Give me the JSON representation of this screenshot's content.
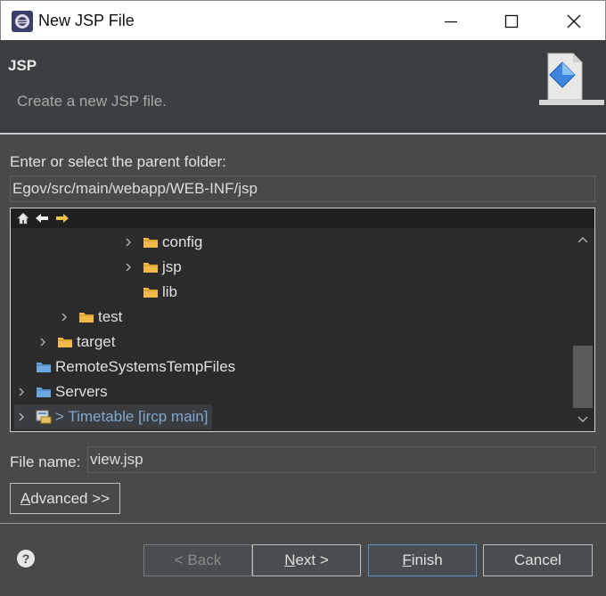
{
  "window": {
    "title": "New JSP File",
    "icon": "eclipse-icon"
  },
  "header": {
    "title": "JSP",
    "description": "Create a new JSP file."
  },
  "folder": {
    "label": "Enter or select the parent folder:",
    "value": "Egov/src/main/webapp/WEB-INF/jsp"
  },
  "tree": {
    "items": [
      {
        "label": "config",
        "expandable": true
      },
      {
        "label": "jsp",
        "expandable": true
      },
      {
        "label": "lib",
        "expandable": false
      },
      {
        "label": "test",
        "expandable": true
      },
      {
        "label": "target",
        "expandable": true
      },
      {
        "label": "RemoteSystemsTempFiles",
        "expandable": false
      },
      {
        "label": "Servers",
        "expandable": true
      },
      {
        "label": "> Timetable [ircp main]",
        "expandable": true,
        "selected": true
      }
    ]
  },
  "file": {
    "label": "File name:",
    "value": "view.jsp"
  },
  "buttons": {
    "advanced_prefix": "A",
    "advanced_rest": "dvanced >>",
    "back": "< Back",
    "next_u": "N",
    "next_rest": "ext >",
    "finish_u": "F",
    "finish_rest": "inish",
    "cancel": "Cancel",
    "help": "?"
  },
  "colors": {
    "background": "#47494b",
    "header_bg": "#3c3f41",
    "tree_bg": "#2b2b2b",
    "folder_icon": "#f0b94a",
    "default_button_border": "#5b8fc9"
  }
}
